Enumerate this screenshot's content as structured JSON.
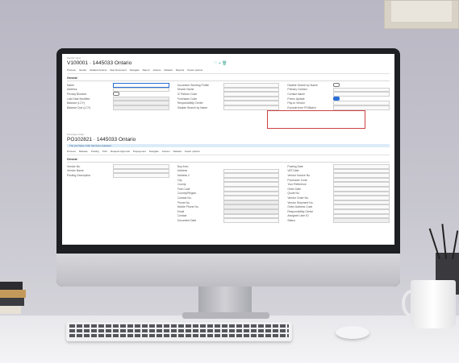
{
  "screen": {
    "top_record": {
      "breadcrumb": "Vendor Card",
      "title": "V100001 · 1445033 Ontario",
      "actions": [
        "Process",
        "Vendor",
        "Related Actions",
        "New Document",
        "Navigate",
        "Report",
        "Actions",
        "Related",
        "Reports",
        "Fewer options"
      ],
      "section": "General",
      "fields_left": [
        "Name",
        "Address",
        "Privacy Blocked",
        "Last Date Modified",
        "Balance (LCY)",
        "Balance Due (LCY)"
      ],
      "fields_mid": [
        "Document Sending Profile",
        "Search Name",
        "IC Partner Code",
        "Purchaser Code",
        "Responsibility Center",
        "Disable Search by Name"
      ],
      "fields_right": [
        "Disable Search by Name",
        "Primary Contact",
        "Contact Name",
        "Prices Update",
        "Pay-to Vendor",
        "Exclude from PO/Batch"
      ]
    },
    "bottom_record": {
      "breadcrumb": "Purchase Order",
      "title": "PO102821 · 1445033 Ontario",
      "banner": "The purchase order has been released",
      "actions": [
        "Process",
        "Release",
        "Posting",
        "Print",
        "Request Approval",
        "Prepayment",
        "Navigate",
        "Actions",
        "Related",
        "Fewer options"
      ],
      "section": "General",
      "fields_left": [
        "Vendor No.",
        "Vendor Name",
        "Posting Description"
      ],
      "fields_mid": [
        "Buy-from",
        "Address",
        "Address 2",
        "City",
        "County",
        "Post Code",
        "Country/Region",
        "Contact No.",
        "Phone No.",
        "Mobile Phone No.",
        "Email",
        "Contact",
        "Document Date"
      ],
      "fields_right": [
        "Posting Date",
        "VAT Date",
        "Vendor Invoice No.",
        "Purchaser Code",
        "Your Reference",
        "Order Date",
        "Quote No.",
        "Vendor Order No.",
        "Vendor Shipment No.",
        "Order Address Code",
        "Responsibility Center",
        "Assigned User ID",
        "Status"
      ]
    }
  },
  "colors": {
    "highlight_box": "#d04040",
    "accent": "#2a6fd6"
  }
}
